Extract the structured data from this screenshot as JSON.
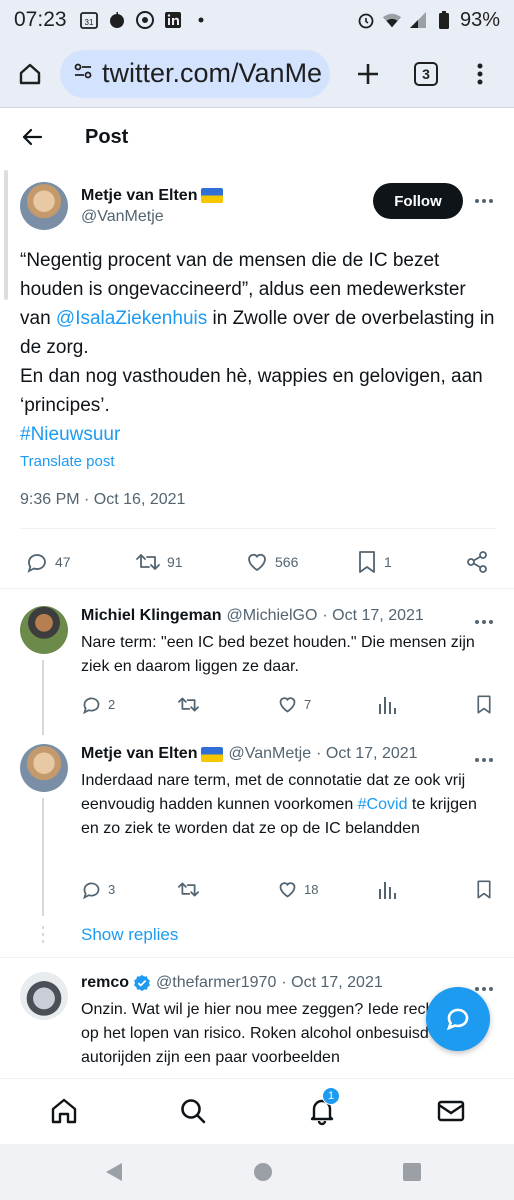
{
  "status_bar": {
    "time": "07:23",
    "calendar_day": "31",
    "battery": "93%",
    "icons": [
      "calendar-icon",
      "apple-icon",
      "chrome-icon",
      "linkedin-icon",
      "dot-icon",
      "alarm-icon",
      "wifi-icon",
      "signal-icon",
      "battery-icon"
    ]
  },
  "browser": {
    "url": "twitter.com/VanMe",
    "tab_count": "3"
  },
  "header": {
    "title": "Post"
  },
  "main_tweet": {
    "author_name": "Metje van Elten",
    "author_handle": "@VanMetje",
    "follow_label": "Follow",
    "text_1": "“Negentig procent van de mensen die de IC bezet houden is ongevaccineerd”, aldus een medewerkster van ",
    "mention": "@IsalaZiekenhuis",
    "text_2": " in Zwolle over de overbelasting in de zorg.",
    "text_3": "En dan nog vasthouden hè, wappies en gelovigen, aan ‘principes’.",
    "hashtag": "#Nieuwsuur",
    "translate": "Translate post",
    "timestamp": "9:36 PM · Oct 16, 2021",
    "stats": {
      "replies": "47",
      "retweets": "91",
      "likes": "566",
      "bookmarks": "1"
    }
  },
  "replies": [
    {
      "name": "Michiel Klingeman",
      "handle": "@MichielGO",
      "date": "· Oct 17, 2021",
      "text": "Nare term: \"een IC bed bezet houden.\" Die mensen zijn ziek en daarom liggen ze daar.",
      "replies": "2",
      "retweets": "",
      "likes": "7"
    },
    {
      "name": "Metje van Elten",
      "handle": "@VanMetje",
      "date": "· Oct 17, 2021",
      "text_1": "Inderdaad nare term, met de connotatie dat ze ook vrij eenvoudig hadden kunnen voorkomen ",
      "hashtag": "#Covid",
      "text_2": " te krijgen en zo ziek te worden dat ze op de IC belandden",
      "replies": "3",
      "retweets": "",
      "likes": "18"
    },
    {
      "name": "remco",
      "handle": "@thefarmer1970",
      "date": "· Oct 17, 2021",
      "text": "Onzin. Wat wil je hier nou mee zeggen? Iede recht op het lopen van risico. Roken alcohol onbesuisd autorijden zijn een paar voorbeelden"
    }
  ],
  "show_replies": "Show replies",
  "bottom_nav": {
    "notification_badge": "1"
  },
  "colors": {
    "accent": "#1d9bf0",
    "text": "#0f1419",
    "muted": "#536471",
    "browser_bg": "#e9eef6"
  }
}
